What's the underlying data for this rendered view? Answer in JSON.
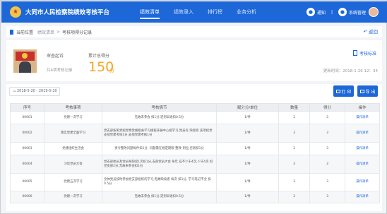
{
  "app": {
    "title": "大同市人民检察院绩效考核平台",
    "logo_glyph": "★"
  },
  "nav": [
    {
      "label": "绩效清单",
      "active": true
    },
    {
      "label": "绩效录入",
      "active": false
    },
    {
      "label": "排行榜",
      "active": false
    },
    {
      "label": "业务分析",
      "active": false
    }
  ],
  "user": {
    "notice_label": "通知",
    "name": "系统管理",
    "separator": "|"
  },
  "breadcrumb": {
    "current_label": "当前位置",
    "link": "绩效清单",
    "separator": ">",
    "page": "考核项得分记录",
    "back_label": "返回"
  },
  "profile": {
    "name": "审查起诉",
    "subtitle": "共6项考核记录",
    "score_label": "累计总得分",
    "score": "150",
    "score_unit": "分",
    "standard_link": "考核标准",
    "update_time": "更新时间：2018-1-26 12：34"
  },
  "filters": {
    "date_range": "2018-5-20 - 2019-5-20"
  },
  "toolbar": {
    "print_label": "打 印",
    "export_label": "导 出"
  },
  "table": {
    "columns": [
      "序号",
      "考核事项",
      "考核情节",
      "赋分分/单位",
      "数量",
      "得分",
      "操作"
    ],
    "rows": [
      {
        "no": "00001",
        "item": "党建一次学习",
        "detail": "无故未参会 扣1分,迟到早退扣0.5分",
        "unit": "1/件",
        "qty": "3",
        "score": "3",
        "op": "操作清单"
      },
      {
        "no": "00002",
        "item": "落实党建全面学习",
        "detail": "党支部按照党组党章党规相关学习规程开展中心组学习,党员有 缺席扣 该项扣党支部党建考核1分,支部党建考核1分",
        "unit": "1/件",
        "qty": "3",
        "score": "3",
        "op": "操作清单"
      },
      {
        "no": "00003",
        "item": "党建组织生活会",
        "detail": "责令整改问题每件扣1分, 问题需在规定期限 整改 到位,否则扣1分",
        "unit": "1/件",
        "qty": "3",
        "score": "3",
        "op": "操作清单"
      },
      {
        "no": "00004",
        "item": "习近党员大会",
        "detail": "党支部委员及党员每缺席1次扣1分,支部党员大会 每年 应不少于4次,少于4次 扣党支部2分,无故未参会扣1分",
        "unit": "1/件",
        "qty": "3",
        "score": "3",
        "op": "操作清单"
      },
      {
        "no": "00005",
        "item": "党建五次学习",
        "detail": "全体党员按时参加党支部组织的学习,无故缺席者 每次 扣1分, 学习笔记不全 扣0.5分",
        "unit": "1/件",
        "qty": "3",
        "score": "3",
        "op": "操作清单"
      },
      {
        "no": "00006",
        "item": "党建一次学习",
        "detail": "无故未参会 扣1分,迟到早退扣0.5分",
        "unit": "1/件",
        "qty": "3",
        "score": "3",
        "op": "操作清单"
      }
    ]
  },
  "colors": {
    "primary": "#1d67d8",
    "score": "#f5a623",
    "page_bg": "#f2f4f7"
  }
}
